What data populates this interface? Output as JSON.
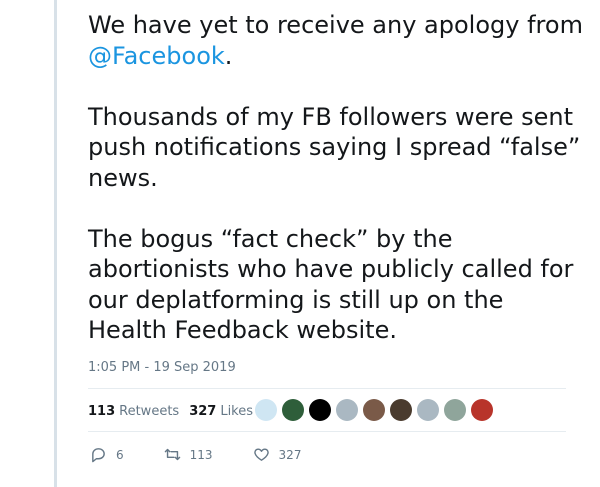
{
  "tweet": {
    "line1": "We have yet to receive any apology from",
    "mention": "@Facebook",
    "line1_end": ".",
    "para2": "Thousands of my FB followers were sent push notifications saying I spread “false” news.",
    "para3": "The bogus “fact check” by the abortionists who have publicly called for our deplatforming is still up on the Health Feedback website.",
    "timestamp": "1:05 PM - 19 Sep 2019"
  },
  "stats": {
    "retweets_count": "113",
    "retweets_label": "Retweets",
    "likes_count": "327",
    "likes_label": "Likes"
  },
  "avatars": [
    {
      "name": "avatar-1",
      "color": "#cfe6f3"
    },
    {
      "name": "avatar-2",
      "color": "#2e5e3a"
    },
    {
      "name": "avatar-3",
      "color": "#000000"
    },
    {
      "name": "avatar-4",
      "color": "#aab8c2"
    },
    {
      "name": "avatar-5",
      "color": "#7a5a48"
    },
    {
      "name": "avatar-6",
      "color": "#4a3b2e"
    },
    {
      "name": "avatar-7",
      "color": "#aab8c2"
    },
    {
      "name": "avatar-8",
      "color": "#8fa59b"
    },
    {
      "name": "avatar-9",
      "color": "#b8342a"
    }
  ],
  "actions": {
    "replies": "6",
    "retweets": "113",
    "likes": "327"
  },
  "icons": {
    "reply": "reply-icon",
    "retweet": "retweet-icon",
    "like": "heart-icon"
  },
  "colors": {
    "link": "#1b95e0",
    "muted": "#657786",
    "thread_line": "#d8e1e8"
  }
}
